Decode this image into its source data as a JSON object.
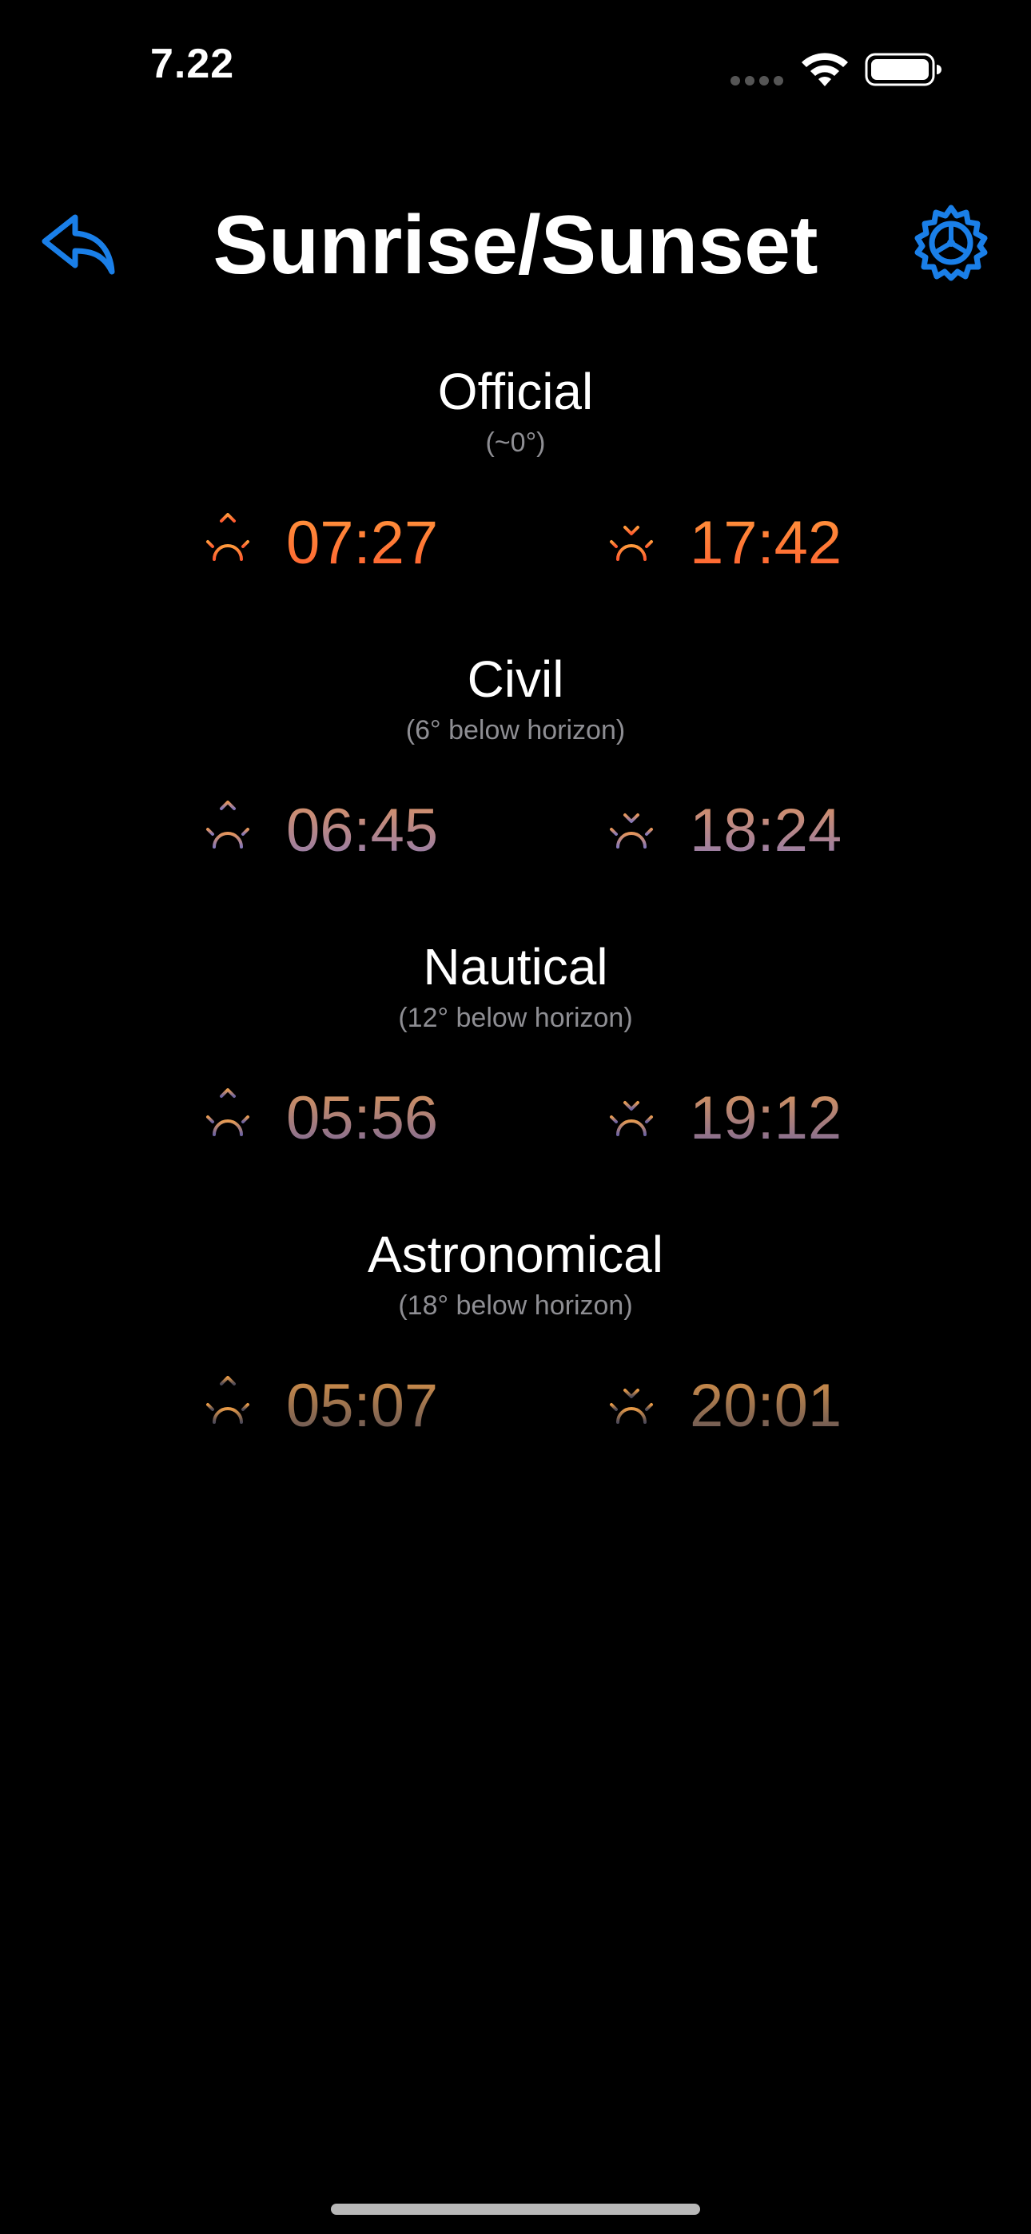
{
  "status_bar": {
    "time": "7.22"
  },
  "nav": {
    "title": "Sunrise/Sunset",
    "back_icon": "back-arrow-icon",
    "settings_icon": "gear-icon"
  },
  "colors": {
    "accent": "#1a7fe8",
    "background": "#000000",
    "subtitle": "#8e8e93"
  },
  "sections": [
    {
      "title": "Official",
      "subtitle": "(~0°)",
      "sunrise": "07:27",
      "sunset": "17:42",
      "gradient": [
        "#ff9a3c",
        "#ff5a30"
      ]
    },
    {
      "title": "Civil",
      "subtitle": "(6° below horizon)",
      "sunrise": "06:45",
      "sunset": "18:24",
      "gradient": [
        "#e5955a",
        "#8577b8"
      ]
    },
    {
      "title": "Nautical",
      "subtitle": "(12° below horizon)",
      "sunrise": "05:56",
      "sunset": "19:12",
      "gradient": [
        "#e79b52",
        "#6e63a1"
      ]
    },
    {
      "title": "Astronomical",
      "subtitle": "(18° below horizon)",
      "sunrise": "05:07",
      "sunset": "20:01",
      "gradient": [
        "#e89a46",
        "#4e4a58"
      ]
    }
  ]
}
